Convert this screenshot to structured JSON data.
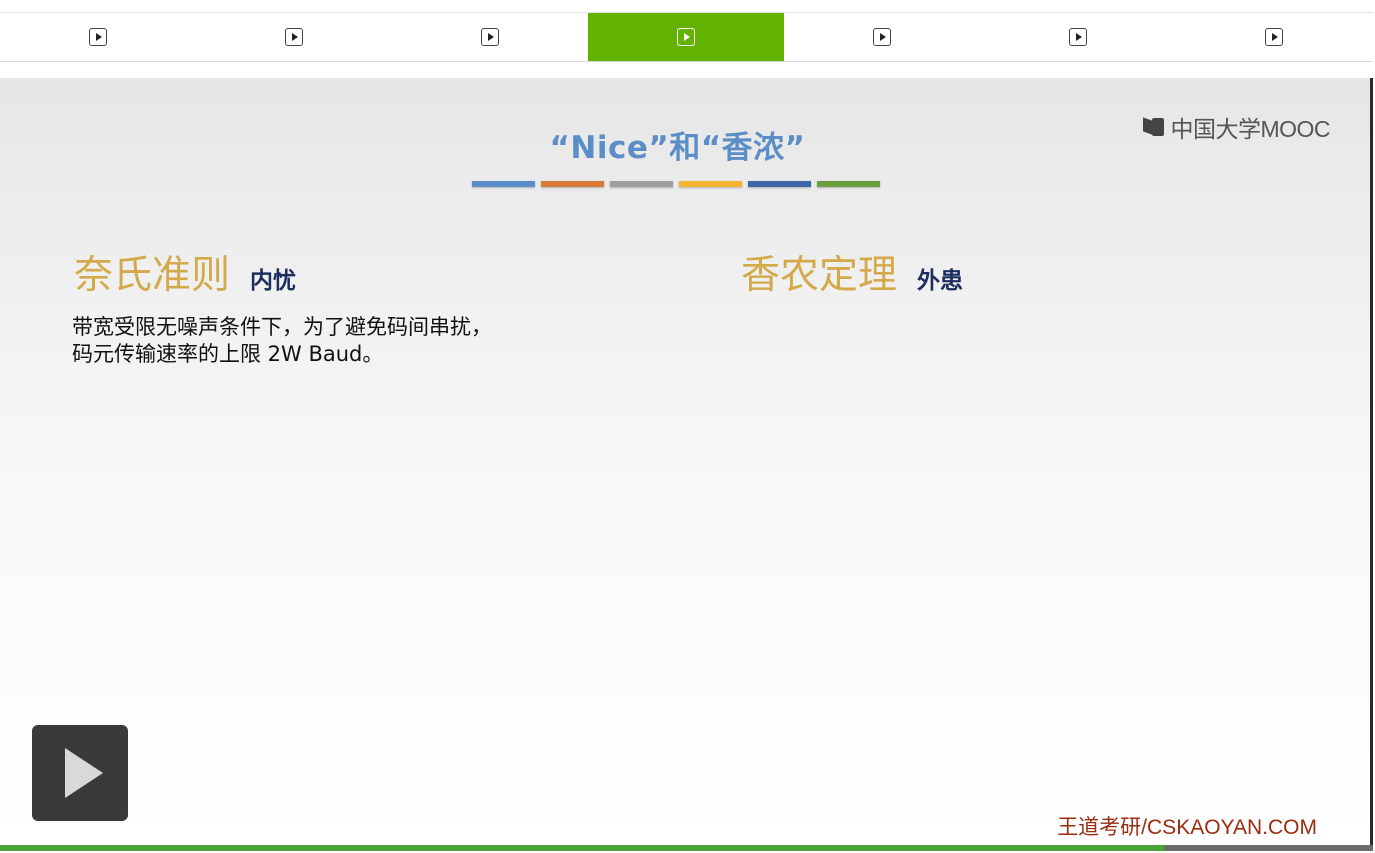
{
  "nav": {
    "tabs": [
      {
        "icon": "play-icon",
        "active": false
      },
      {
        "icon": "play-icon",
        "active": false
      },
      {
        "icon": "play-icon",
        "active": false
      },
      {
        "icon": "play-icon",
        "active": true
      },
      {
        "icon": "play-icon",
        "active": false
      },
      {
        "icon": "play-icon",
        "active": false
      },
      {
        "icon": "play-icon",
        "active": false
      }
    ],
    "active_color": "#62b300"
  },
  "slide": {
    "title": "“Nice”和“香浓”",
    "title_color": "#5b8ec6",
    "color_bars": [
      "#5b8ec6",
      "#d97a3a",
      "#9e9e9e",
      "#f1b532",
      "#3e66a8",
      "#6a9e3e"
    ],
    "logo_text": "中国大学MOOC",
    "left": {
      "heading": "奈氏准则",
      "tag": "内忧",
      "line1": "带宽受限无噪声条件下，为了避免码间串扰，",
      "line2": "码元传输速率的上限 2W Baud。"
    },
    "right": {
      "heading": "香农定理",
      "tag": "外患"
    },
    "footer_brand": "王道考研/CSKAOYAN.COM",
    "heading_color": "#d4a94a"
  },
  "player": {
    "play_icon": "play-icon",
    "progress": 0.848
  }
}
